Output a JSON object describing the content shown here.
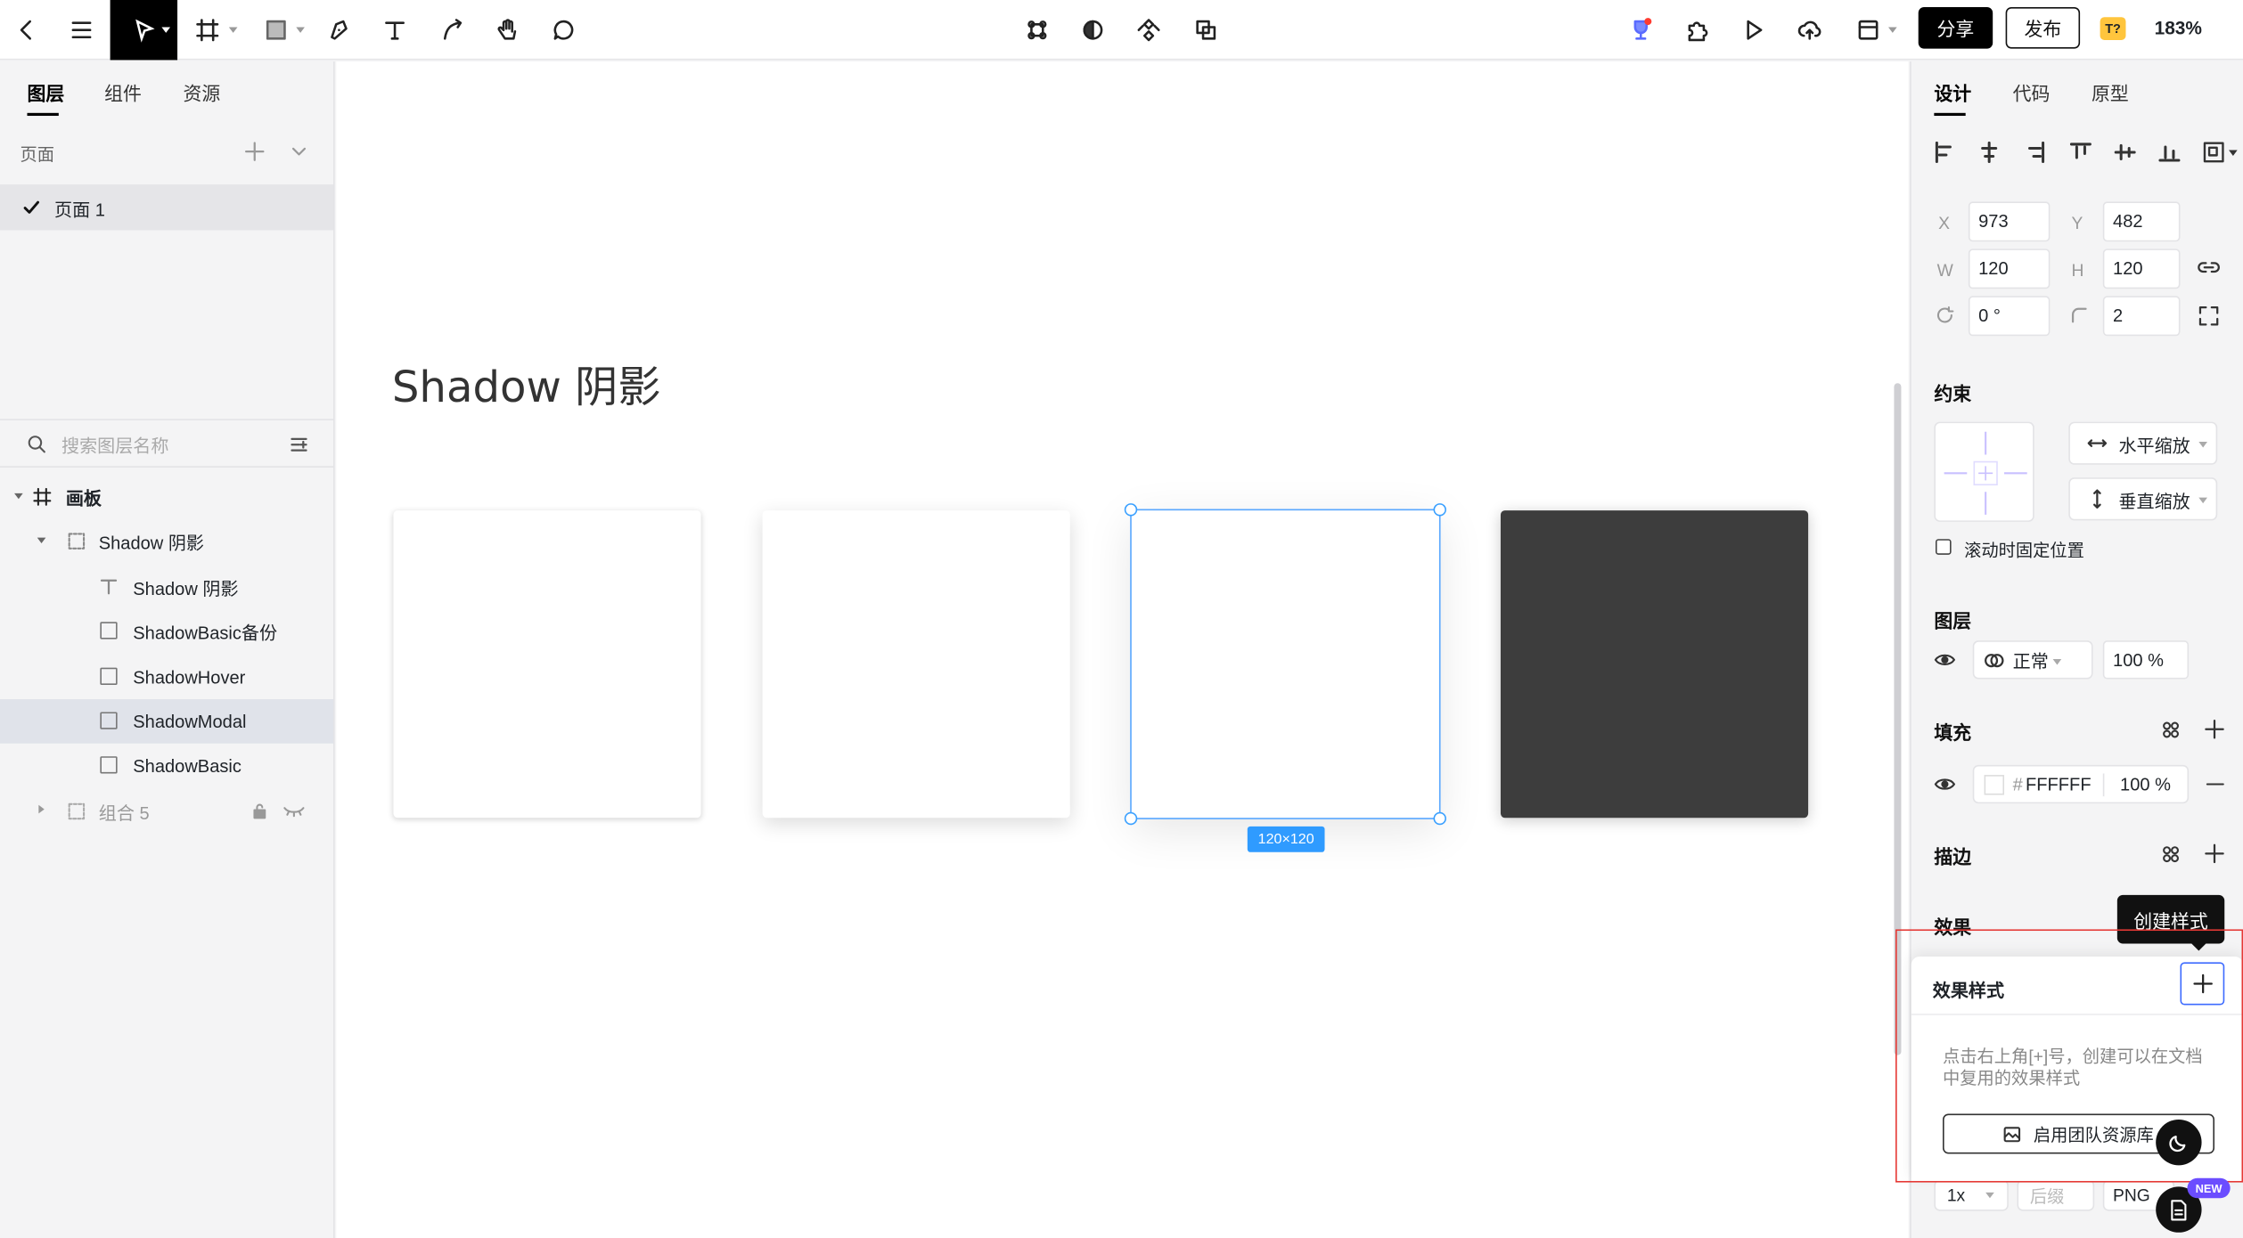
{
  "toolbar": {
    "share_label": "分享",
    "publish_label": "发布",
    "badge": "T?",
    "zoom": "183%"
  },
  "left_panel": {
    "tabs": [
      {
        "label": "图层",
        "active": true
      },
      {
        "label": "组件",
        "active": false
      },
      {
        "label": "资源",
        "active": false
      }
    ],
    "pages_label": "页面",
    "page_item": "页面 1",
    "search_placeholder": "搜索图层名称",
    "layers": [
      {
        "label": "画板",
        "type": "frame"
      },
      {
        "label": "Shadow 阴影",
        "type": "group"
      },
      {
        "label": "Shadow 阴影",
        "type": "text"
      },
      {
        "label": "ShadowBasic备份",
        "type": "rect"
      },
      {
        "label": "ShadowHover",
        "type": "rect"
      },
      {
        "label": "ShadowModal",
        "type": "rect",
        "selected": true
      },
      {
        "label": "ShadowBasic",
        "type": "rect"
      },
      {
        "label": "组合 5",
        "type": "group",
        "hidden": true
      }
    ]
  },
  "canvas": {
    "title": "Shadow 阴影",
    "size_tag": "120×120",
    "cards": [
      {
        "fill": "#FFFFFF"
      },
      {
        "fill": "#FFFFFF"
      },
      {
        "fill": "#FFFFFF",
        "selected": true
      },
      {
        "fill": "#3D3D3D"
      }
    ]
  },
  "right_panel": {
    "tabs": [
      {
        "label": "设计",
        "active": true
      },
      {
        "label": "代码",
        "active": false
      },
      {
        "label": "原型",
        "active": false
      }
    ],
    "x_label": "X",
    "x": "973",
    "y_label": "Y",
    "y": "482",
    "w_label": "W",
    "w": "120",
    "h_label": "H",
    "h": "120",
    "rotation": "0 °",
    "radius": "2",
    "constraints_title": "约束",
    "constraint_h": "水平缩放",
    "constraint_v": "垂直缩放",
    "fix_on_scroll": "滚动时固定位置",
    "layer_title": "图层",
    "blend_mode": "正常",
    "layer_opacity": "100 %",
    "fill_title": "填充",
    "fill_hex": "FFFFFF",
    "fill_opacity": "100 %",
    "stroke_title": "描边",
    "effect_title": "效果",
    "export_scale": "1x",
    "export_suffix": "后缀",
    "export_format": "PNG"
  },
  "tooltip": "创建样式",
  "popup": {
    "title": "效果样式",
    "hint": "点击右上角[+]号，创建可以在文档中复用的效果样式",
    "enable_button": "启用团队资源库"
  },
  "new_tag": "NEW"
}
